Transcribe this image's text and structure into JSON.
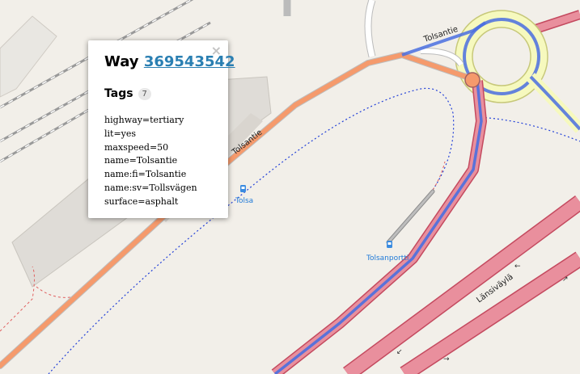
{
  "map": {
    "labels": {
      "road_left": "Tolsantie",
      "road_right": "Tolsantie",
      "highway": "Länsiväylä",
      "stop_tolsa": "Tolsa",
      "stop_tolsanportti": "Tolsanportti"
    }
  },
  "popup": {
    "title_prefix": "Way",
    "way_id": "369543542",
    "close_symbol": "×",
    "tags_heading": "Tags",
    "tags_count": "7",
    "tags": [
      "highway=tertiary",
      "lit=yes",
      "maxspeed=50",
      "name=Tolsantie",
      "name:fi=Tolsantie",
      "name:sv=Tollsvägen",
      "surface=asphalt"
    ]
  }
}
